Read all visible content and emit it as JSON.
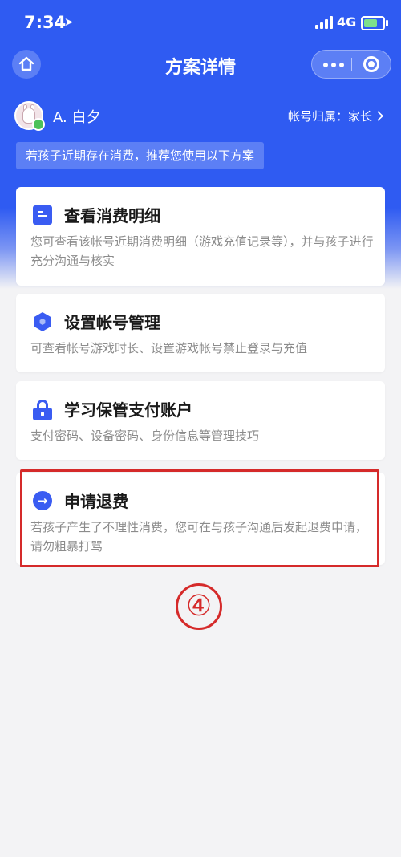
{
  "status_bar": {
    "time": "7:34",
    "network": "4G"
  },
  "nav": {
    "title": "方案详情"
  },
  "user": {
    "name": "A. 白夕",
    "owner_label": "帐号归属：家长"
  },
  "banner": {
    "text": "若孩子近期存在消费，推荐您使用以下方案"
  },
  "cards": [
    {
      "icon": "document-icon",
      "title": "查看消费明细",
      "desc": "您可查看该帐号近期消费明细（游戏充值记录等），并与孩子进行充分沟通与核实"
    },
    {
      "icon": "hexagon-icon",
      "title": "设置帐号管理",
      "desc": "可查看帐号游戏时长、设置游戏帐号禁止登录与充值"
    },
    {
      "icon": "lock-icon",
      "title": "学习保管支付账户",
      "desc": "支付密码、设备密码、身份信息等管理技巧"
    },
    {
      "icon": "arrow-circle-icon",
      "title": "申请退费",
      "desc": "若孩子产生了不理性消费，您可在与孩子沟通后发起退费申请，请勿粗暴打骂"
    }
  ],
  "annotation": {
    "step_number": "④"
  },
  "colors": {
    "primary": "#2f5bf2",
    "highlight": "#d52a2a"
  }
}
